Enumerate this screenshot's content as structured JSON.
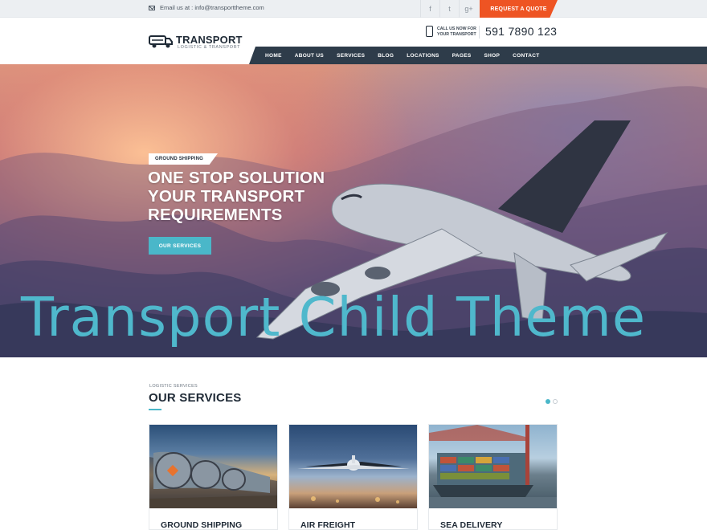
{
  "topbar": {
    "email_text": "Email us at : info@transporttheme.com",
    "social": [
      {
        "icon": "facebook-icon",
        "glyph": "f"
      },
      {
        "icon": "twitter-icon",
        "glyph": "t"
      },
      {
        "icon": "google-plus-icon",
        "glyph": "g+"
      }
    ],
    "quote_label": "REQUEST A QUOTE"
  },
  "header": {
    "logo_title": "TRANSPORT",
    "logo_subtitle": "LOGISTIC & TRANSPORT",
    "call_label": "CALL US NOW FOR YOUR TRANSPORT",
    "phone": "591 7890 123"
  },
  "nav": {
    "items": [
      "HOME",
      "ABOUT US",
      "SERVICES",
      "BLOG",
      "LOCATIONS",
      "PAGES",
      "SHOP",
      "CONTACT"
    ]
  },
  "hero": {
    "badge": "GROUND SHIPPING",
    "lines": [
      "ONE STOP SOLUTION",
      "YOUR TRANSPORT",
      "REQUIREMENTS"
    ],
    "button": "OUR SERVICES",
    "watermark": "Transport Child Theme"
  },
  "services": {
    "kicker": "LOGISTIC SERVICES",
    "title": "OUR SERVICES",
    "cards": [
      {
        "label": "GROUND SHIPPING"
      },
      {
        "label": "AIR FREIGHT"
      },
      {
        "label": "SEA DELIVERY"
      }
    ]
  },
  "colors": {
    "accent_orange": "#ee5423",
    "accent_teal": "#4ab7c9",
    "nav_dark": "#2e3c4a"
  }
}
